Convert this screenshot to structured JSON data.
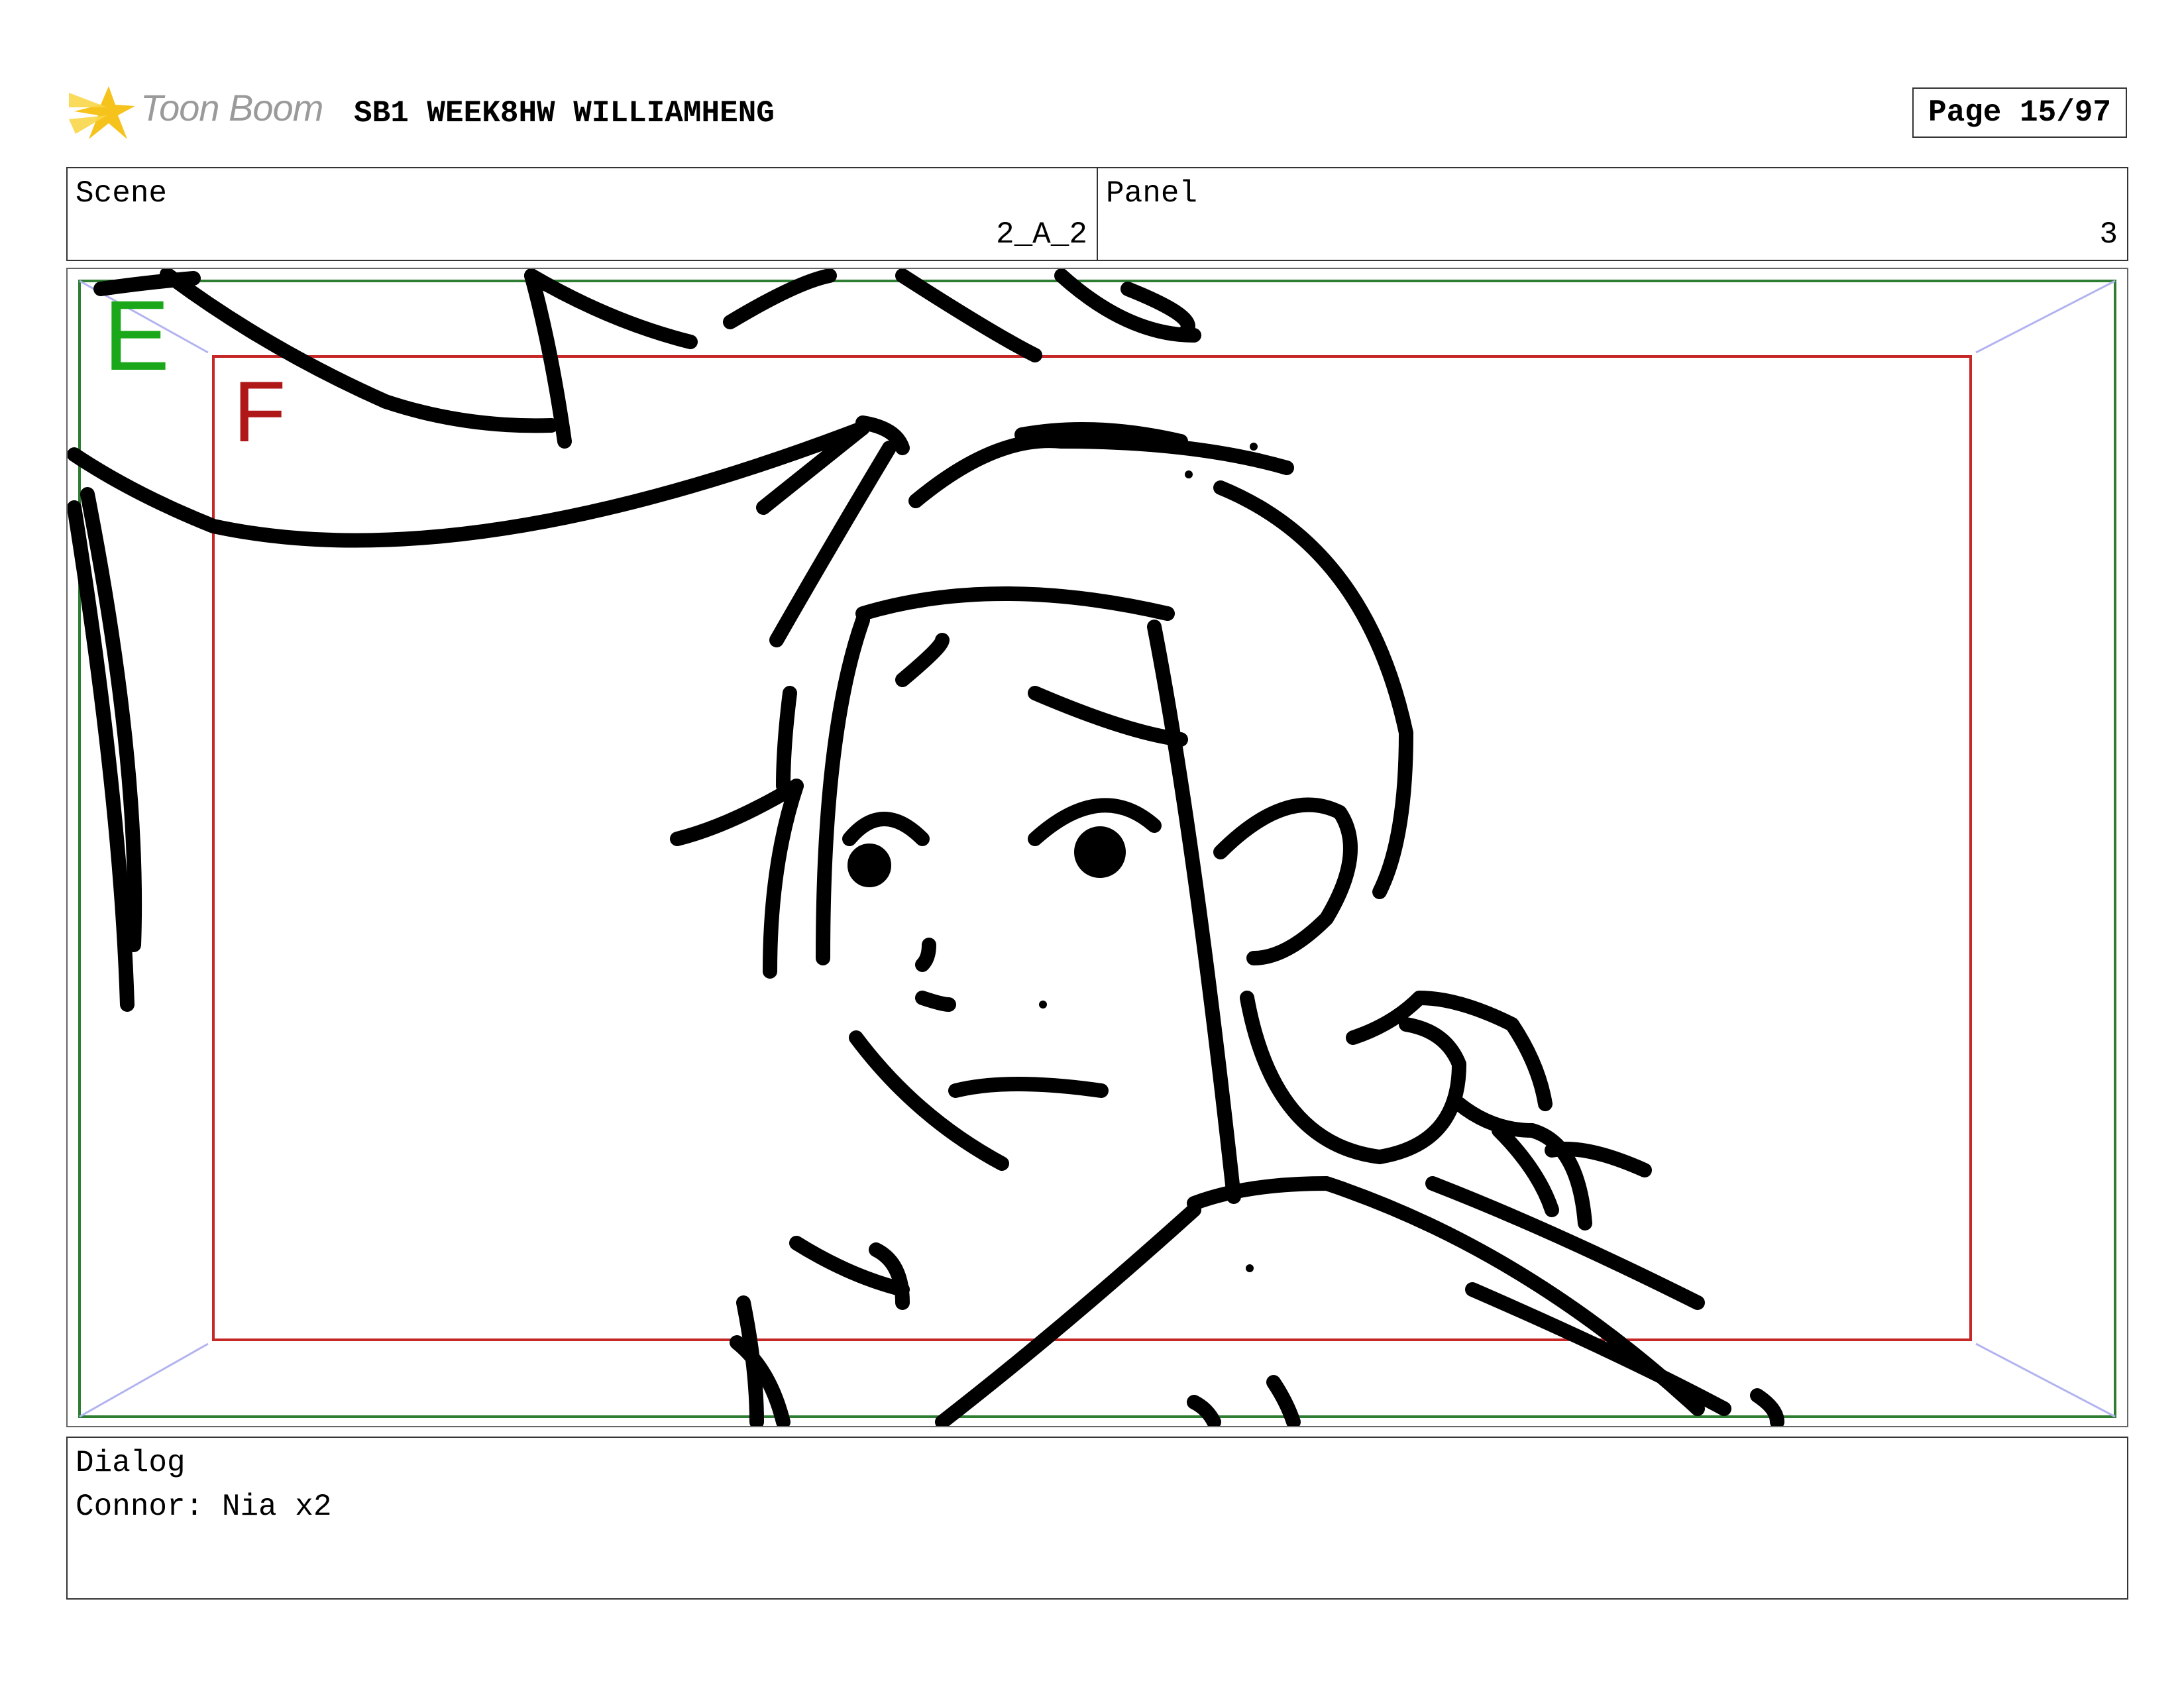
{
  "header": {
    "logo_text": "Toon Boom",
    "project_title": "SB1 WEEK8HW WILLIAMHENG",
    "page_label": "Page 15/97"
  },
  "info": {
    "scene_label": "Scene",
    "scene_value": "2_A_2",
    "panel_label": "Panel",
    "panel_value": "3"
  },
  "panel_image": {
    "outer_frame_letter": "E",
    "inner_frame_letter": "F",
    "outer_frame_color": "#2e7d32",
    "inner_frame_color": "#c62828",
    "guide_arrow_color": "#b3b3f0"
  },
  "dialog": {
    "label": "Dialog",
    "text": "Connor: Nia x2"
  }
}
